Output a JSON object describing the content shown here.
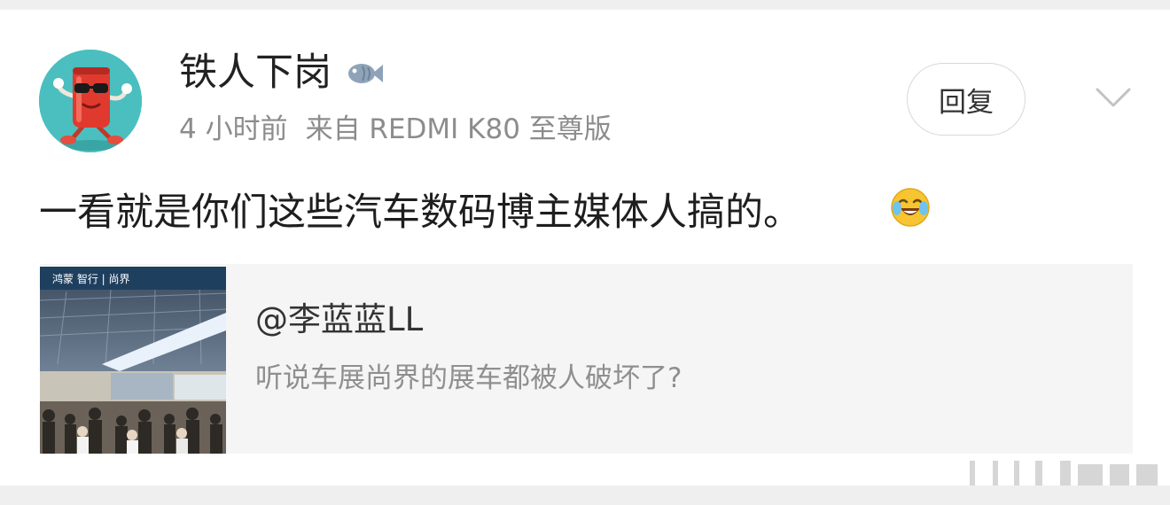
{
  "post": {
    "author": "铁人下岗",
    "author_badge_icon": "fish-icon",
    "time": "4 小时前",
    "source": "来自 REDMI K80 至尊版",
    "reply_label": "回复",
    "more_icon": "chevron-down-icon",
    "text": "一看就是你们这些汽车数码博主媒体人搞的。",
    "emoji": "laughing-crying-emoji"
  },
  "quote": {
    "author": "@李蓝蓝LL",
    "text": "听说车展尚界的展车都被人破坏了?",
    "thumbnail_banner": "鸿蒙 智行 | 尚界"
  },
  "colors": {
    "background": "#efefef",
    "card": "#ffffff",
    "quote_background": "#f5f5f5",
    "avatar": "#4bbfbf",
    "muted_text": "#8c8c8c"
  }
}
